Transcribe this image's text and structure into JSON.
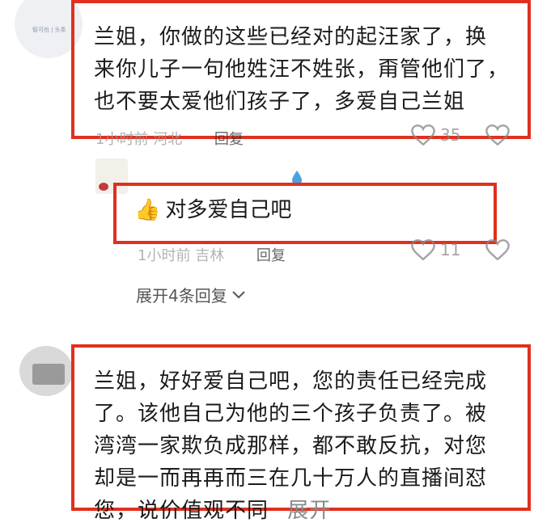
{
  "comment1": {
    "text_lines": [
      "兰姐，你做的这些已经对的起汪家了，换",
      "来你儿子一句他姓汪不姓张，甭管他们了，",
      "也不要太爱他们孩子了，多爱自己兰姐"
    ],
    "time": "1小时前",
    "location": "河北",
    "reply_label": "回复",
    "likes": "35",
    "avatar_tag": "智可也 | 头条"
  },
  "reply1": {
    "text": "对多爱自己吧",
    "emoji": "👍",
    "time": "1小时前",
    "location": "吉林",
    "reply_label": "回复",
    "likes": "11",
    "expand_label": "展开4条回复"
  },
  "comment2": {
    "text_lines": [
      "兰姐，好好爱自己吧，您的责任已经完成",
      "了。该他自己为他的三个孩子负责了。被",
      "湾湾一家欺负成那样，都不敢反抗，对您",
      "却是一而再再而三在几十万人的直播间怼",
      "您，说价值观不同"
    ],
    "more_label": "展开"
  },
  "colors": {
    "highlight_box": "#e0301e",
    "meta_text": "#9a9a9a",
    "heart_outline": "#888888"
  }
}
